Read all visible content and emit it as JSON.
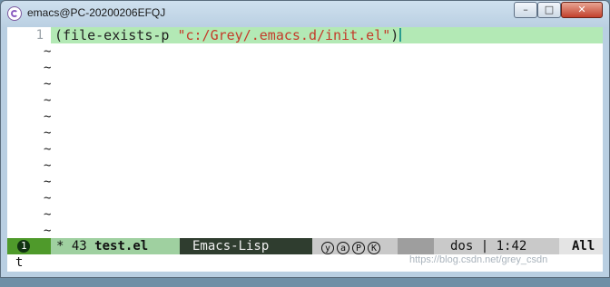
{
  "window": {
    "title": "emacs@PC-20200206EFQJ",
    "controls": {
      "minimize": "–",
      "maximize": "□",
      "close": "✕"
    }
  },
  "editor": {
    "line_number": "1",
    "code_prefix": "(file-exists-p ",
    "code_string": "\"c:/Grey/.emacs.d/init.el\"",
    "code_suffix": ")",
    "empty_marker": "~",
    "colors": {
      "current_line": "#b3e9b5",
      "string": "#c43b2a"
    }
  },
  "modeline": {
    "window_number": "1",
    "modified": "*",
    "size": "43",
    "buffer_name": "test.el",
    "major_mode": "Emacs-Lisp",
    "minor_modes": [
      "y",
      "a",
      "P",
      "K"
    ],
    "encoding": "dos",
    "position": "1:42",
    "percent": "All"
  },
  "minibuffer": {
    "text": "t"
  },
  "watermark": "https://blog.csdn.net/grey_csdn"
}
